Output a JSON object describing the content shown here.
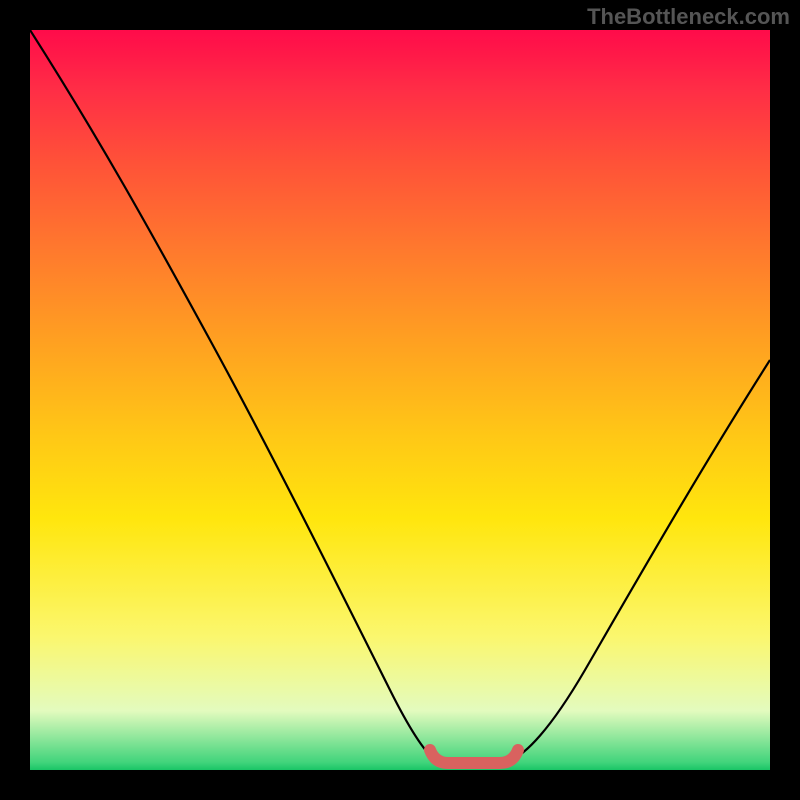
{
  "watermark": "TheBottleneck.com",
  "chart_data": {
    "type": "line",
    "title": "",
    "xlabel": "",
    "ylabel": "",
    "xlim": [
      0,
      100
    ],
    "ylim": [
      0,
      100
    ],
    "series": [
      {
        "name": "bottleneck-curve",
        "x": [
          0,
          8,
          15,
          22,
          30,
          38,
          45,
          51,
          54,
          56,
          60,
          64,
          67,
          72,
          80,
          90,
          100
        ],
        "y": [
          100,
          87,
          75,
          62,
          48,
          33,
          18,
          6,
          1,
          0,
          0,
          0,
          1,
          6,
          18,
          35,
          52
        ]
      }
    ],
    "annotations": [
      {
        "name": "trough-marker",
        "x_range": [
          54,
          67
        ],
        "y": 0
      }
    ]
  }
}
